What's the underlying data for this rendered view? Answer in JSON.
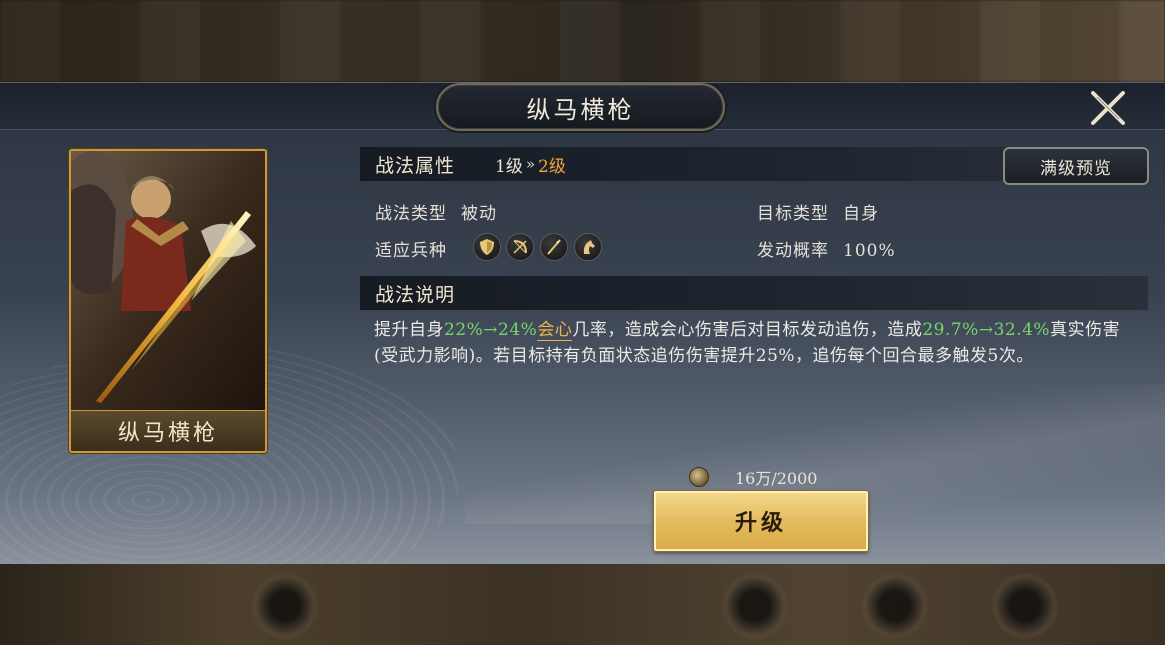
{
  "dialog": {
    "title": "纵马横枪",
    "close_icon": "close-x-icon"
  },
  "card": {
    "name": "纵马横枪",
    "art": "general-with-golden-spear-illustration"
  },
  "attributes": {
    "section_title": "战法属性",
    "level_from": "1级",
    "level_arrow": "»",
    "level_to": "2级",
    "preview_button": "满级预览",
    "type_label": "战法类型",
    "type_value": "被动",
    "target_label": "目标类型",
    "target_value": "自身",
    "troops_label": "适应兵种",
    "troop_icons": [
      "shield-troop-icon",
      "bow-troop-icon",
      "spear-troop-icon",
      "horse-troop-icon"
    ],
    "chance_label": "发动概率",
    "chance_value": "100%"
  },
  "description": {
    "section_title": "战法说明",
    "p1": "提升自身",
    "crit_rate_change": "22%→24%",
    "crit_keyword": "会心",
    "p2": "几率，造成会心伤害后对目标发动追伤，造成",
    "damage_change": "29.7%→32.4%",
    "p3": "真实伤害(受武力影响)。若目标持有负面状态追伤伤害提升25%，追伤每个回合最多触发5次。"
  },
  "upgrade": {
    "cost_icon": "coin-icon",
    "cost_text": "16万/2000",
    "button_label": "升级"
  },
  "colors": {
    "accent_gold": "#f0a340",
    "green_value": "#7ad36b",
    "button_gold": "#e3bb5e"
  }
}
